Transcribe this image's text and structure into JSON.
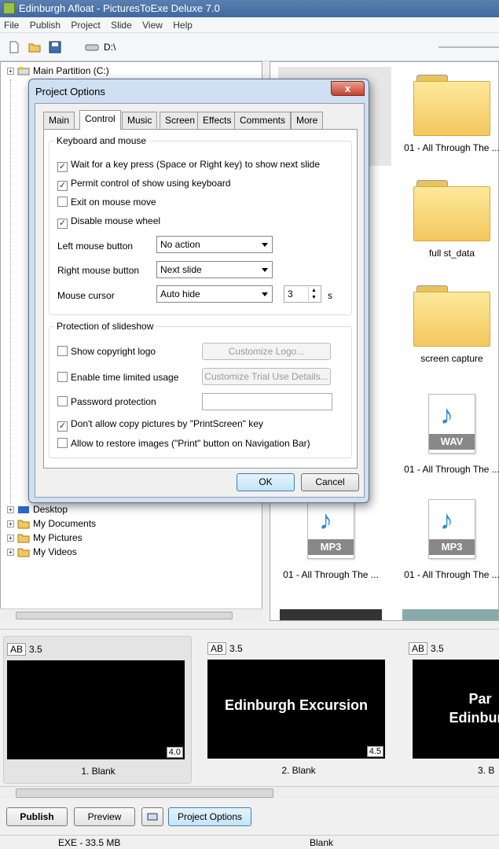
{
  "window": {
    "title": "Edinburgh Afloat - PicturesToExe Deluxe 7.0"
  },
  "menu": [
    "File",
    "Publish",
    "Project",
    "Slide",
    "View",
    "Help"
  ],
  "toolbar": {
    "drive": "D:\\"
  },
  "tree": {
    "items": [
      {
        "label": "Main Partition (C:)"
      },
      {
        "label": "Desktop"
      },
      {
        "label": "My Documents"
      },
      {
        "label": "My Pictures"
      },
      {
        "label": "My Videos"
      }
    ]
  },
  "files": {
    "items": [
      {
        "kind": "folder",
        "label": "01 - All Through The ..."
      },
      {
        "kind": "folder",
        "label": "full st_data"
      },
      {
        "kind": "folder",
        "label": "screen capture"
      },
      {
        "kind": "wav",
        "badge": "WAV",
        "label": "01 - All Through The ..."
      },
      {
        "kind": "mp3",
        "badge": "MP3",
        "label": "01 - All Through The ..."
      },
      {
        "kind": "mp3",
        "badge": "MP3",
        "label": "01 - All Through The ..."
      }
    ]
  },
  "slides": [
    {
      "ab": "AB",
      "time": "3.5",
      "text": "",
      "duration": "4.0",
      "caption": "1. Blank"
    },
    {
      "ab": "AB",
      "time": "3.5",
      "text": "Edinburgh Excursion",
      "duration": "4.5",
      "caption": "2. Blank"
    },
    {
      "ab": "AB",
      "time": "3.5",
      "text": "Par\nEdinburg",
      "duration": "",
      "caption": "3. B"
    }
  ],
  "bottom": {
    "publish": "Publish",
    "preview": "Preview",
    "project_options": "Project Options"
  },
  "status": {
    "size": "EXE - 33.5 MB",
    "slide": "Blank"
  },
  "dialog": {
    "title": "Project Options",
    "close": "x",
    "tabs": [
      "Main",
      "Control",
      "Music",
      "Screen",
      "Effects",
      "Comments",
      "More"
    ],
    "active_tab": "Control",
    "keyboard_group": "Keyboard and mouse",
    "checks1": [
      {
        "label": "Wait for a key press (Space or Right key) to show next slide",
        "checked": true
      },
      {
        "label": "Permit control of show using keyboard",
        "checked": true
      },
      {
        "label": "Exit on mouse move",
        "checked": false
      },
      {
        "label": "Disable mouse wheel",
        "checked": true
      }
    ],
    "left_mouse_label": "Left mouse button",
    "left_mouse_value": "No action",
    "right_mouse_label": "Right mouse button",
    "right_mouse_value": "Next slide",
    "cursor_label": "Mouse cursor",
    "cursor_value": "Auto hide",
    "cursor_seconds": "3",
    "cursor_unit": "s",
    "protection_group": "Protection of slideshow",
    "checks2": [
      {
        "label": "Show copyright logo",
        "checked": false
      },
      {
        "label": "Enable time limited usage",
        "checked": false
      },
      {
        "label": "Password protection",
        "checked": false
      },
      {
        "label": "Don't allow copy pictures by \"PrintScreen\" key",
        "checked": true
      },
      {
        "label": "Allow to restore images (\"Print\" button on Navigation Bar)",
        "checked": false
      }
    ],
    "customize_logo": "Customize Logo...",
    "customize_trial": "Customize Trial Use Details...",
    "ok": "OK",
    "cancel": "Cancel"
  },
  "colors": {
    "accent": "#3c7fb1",
    "folder": "#f3c860",
    "note": "#2a8ad8"
  }
}
